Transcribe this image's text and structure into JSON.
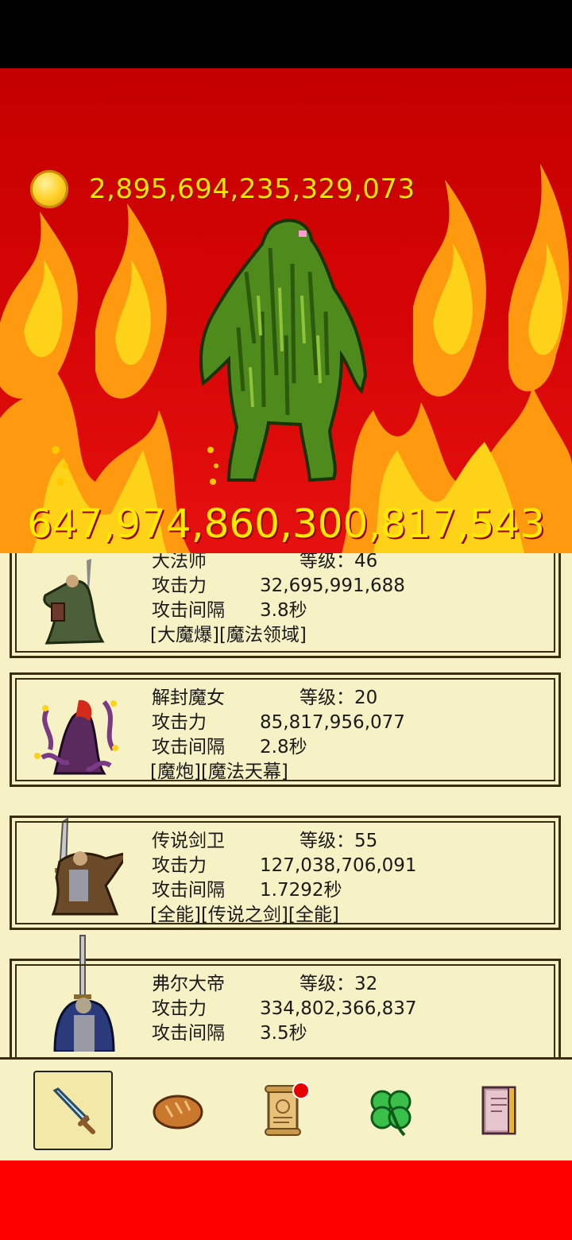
{
  "gold": {
    "icon": "gold-coin-icon",
    "amount": "2,895,694,235,329,073"
  },
  "monster": {
    "icon": "green-swamp-monster",
    "hp": "647,974,860,300,817,543"
  },
  "heroes": [
    {
      "name": "大法师",
      "level_label": "等级：46",
      "attack_label": "攻击力",
      "attack": "32,695,991,688",
      "interval_label": "攻击间隔",
      "interval": "3.8秒",
      "skills": "[大魔爆][魔法领域]",
      "portrait": "archmage-portrait"
    },
    {
      "name": "解封魔女",
      "level_label": "等级：20",
      "attack_label": "攻击力",
      "attack": "85,817,956,077",
      "interval_label": "攻击间隔",
      "interval": "2.8秒",
      "skills": "[魔炮][魔法天幕]",
      "portrait": "witch-portrait"
    },
    {
      "name": "传说剑卫",
      "level_label": "等级：55",
      "attack_label": "攻击力",
      "attack": "127,038,706,091",
      "interval_label": "攻击间隔",
      "interval": "1.7292秒",
      "skills": "[全能][传说之剑][全能]",
      "portrait": "sword-guard-portrait"
    },
    {
      "name": "弗尔大帝",
      "level_label": "等级：32",
      "attack_label": "攻击力",
      "attack": "334,802,366,837",
      "interval_label": "攻击间隔",
      "interval": "3.5秒",
      "portrait": "emperor-portrait"
    }
  ],
  "nav": [
    {
      "icon": "sword-icon",
      "active": true
    },
    {
      "icon": "bread-icon"
    },
    {
      "icon": "scroll-icon",
      "badge": true
    },
    {
      "icon": "clover-icon"
    },
    {
      "icon": "book-icon"
    }
  ],
  "colors": {
    "battle_bg": "#d40404",
    "gold_text": "#ffe600",
    "card_bg": "#f7f1c6",
    "card_border": "#3a2e10",
    "bottom_bar": "#ff0000"
  }
}
